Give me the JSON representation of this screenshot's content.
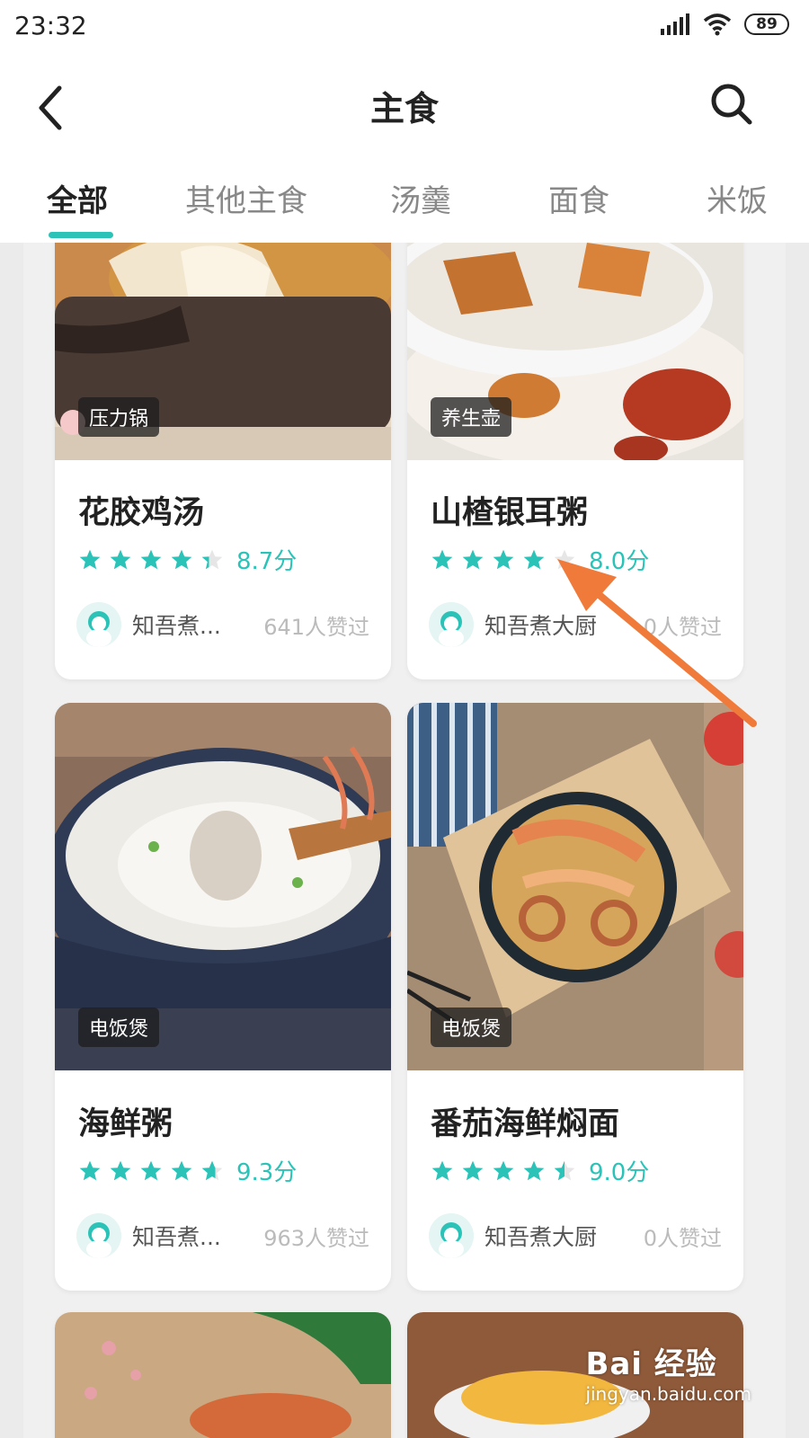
{
  "status_bar": {
    "time": "23:32",
    "battery": "89"
  },
  "nav": {
    "title": "主食"
  },
  "tabs": [
    {
      "label": "全部",
      "active": true
    },
    {
      "label": "其他主食",
      "active": false
    },
    {
      "label": "汤羹",
      "active": false
    },
    {
      "label": "面食",
      "active": false
    },
    {
      "label": "米饭",
      "active": false
    }
  ],
  "recipes": [
    {
      "tag": "压力锅",
      "title": "花胶鸡汤",
      "rating": 8.7,
      "score": "8.7分",
      "author": "知吾煮...",
      "likes": "641人赞过"
    },
    {
      "tag": "养生壶",
      "title": "山楂银耳粥",
      "rating": 8.0,
      "score": "8.0分",
      "author": "知吾煮大厨",
      "likes": "0人赞过"
    },
    {
      "tag": "电饭煲",
      "title": "海鲜粥",
      "rating": 9.3,
      "score": "9.3分",
      "author": "知吾煮...",
      "likes": "963人赞过"
    },
    {
      "tag": "电饭煲",
      "title": "番茄海鲜焖面",
      "rating": 9.0,
      "score": "9.0分",
      "author": "知吾煮大厨",
      "likes": "0人赞过"
    }
  ],
  "colors": {
    "accent": "#2bc3b8",
    "arrow": "#f07a3a"
  },
  "watermark": {
    "brand": "Bai 经验",
    "url": "jingyan.baidu.com"
  }
}
